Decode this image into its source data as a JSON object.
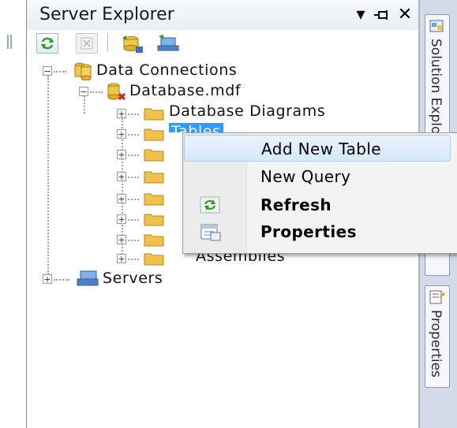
{
  "panel": {
    "title": "Server Explorer",
    "header_buttons": [
      "dropdown-arrow-icon",
      "pin-icon",
      "close-icon"
    ],
    "close_glyph": "✕",
    "pin_glyph": "⊣",
    "dropdown_glyph": "▾"
  },
  "toolbar": {
    "buttons": [
      "refresh-icon",
      "stop-icon",
      "connect-to-database-icon",
      "connect-to-server-icon"
    ]
  },
  "tree": {
    "root": "Data Connections",
    "database": "Database.mdf",
    "children": [
      "Database Diagrams",
      "Tables",
      "",
      "",
      "",
      "",
      "",
      "Assemblies"
    ],
    "servers": "Servers",
    "expand_glyph": "+",
    "collapse_glyph": "−"
  },
  "context_menu": {
    "items": [
      {
        "label": "Add New Table",
        "icon": "",
        "highlighted": true
      },
      {
        "label": "New Query",
        "icon": ""
      },
      {
        "label": "Refresh",
        "icon": "refresh-icon"
      },
      {
        "label": "Properties",
        "icon": "properties-icon"
      }
    ]
  },
  "side_tabs": {
    "solution_explorer": "Solution Explorer",
    "properties": "Properties"
  },
  "colors": {
    "selection": "#3399ff",
    "folder": "#f0c24a",
    "menu_highlight": "#d6e8fb"
  }
}
